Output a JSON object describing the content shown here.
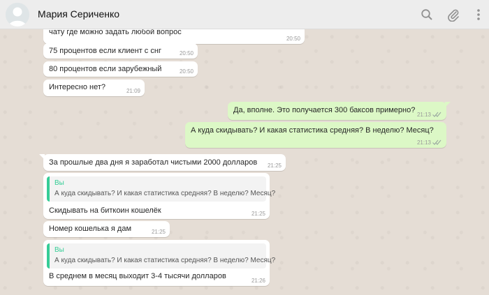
{
  "header": {
    "contact_name": "Мария Сериченко",
    "icons": [
      "search-icon",
      "attach-icon",
      "menu-icon"
    ]
  },
  "colors": {
    "incoming_bubble": "#ffffff",
    "outgoing_bubble": "#dcf8c6",
    "quote_accent": "#35cd96",
    "read_ticks": "#9aa7a0"
  },
  "messages": [
    {
      "direction": "in",
      "text": "чату где можно задать любой вопрос",
      "time": "20:50"
    },
    {
      "direction": "in",
      "text": "75 процентов если клиент с снг",
      "time": "20:50"
    },
    {
      "direction": "in",
      "text": "80 процентов если зарубежный",
      "time": "20:50"
    },
    {
      "direction": "in",
      "text": "Интересно нет?",
      "time": "21:09"
    },
    {
      "direction": "out",
      "text": "Да, вполне. Это получается 300 баксов примерно?",
      "time": "21:13",
      "status": "read"
    },
    {
      "direction": "out",
      "text": "А куда скидывать? И какая статистика средняя? В неделю? Месяц?",
      "time": "21:13",
      "status": "read"
    },
    {
      "direction": "in",
      "text": "За прошлые два дня я заработал чистыми 2000 долларов",
      "time": "21:25"
    },
    {
      "direction": "in",
      "text": "Скидывать на биткоин кошелёк",
      "time": "21:25",
      "quote": {
        "author": "Вы",
        "text": "А куда скидывать? И какая статистика средняя? В неделю? Месяц?"
      }
    },
    {
      "direction": "in",
      "text": "Номер кошелька я дам",
      "time": "21:25"
    },
    {
      "direction": "in",
      "text": "В среднем в месяц выходит 3-4 тысячи долларов",
      "time": "21:26",
      "quote": {
        "author": "Вы",
        "text": "А куда скидывать? И какая статистика средняя? В неделю? Месяц?"
      }
    }
  ]
}
